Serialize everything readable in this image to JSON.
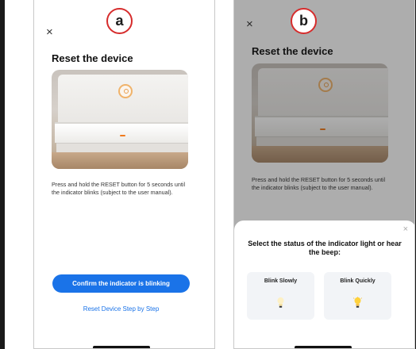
{
  "panels": {
    "a": {
      "badge": "a",
      "close": "×",
      "title": "Reset the device",
      "description": "Press and hold the RESET button for 5 seconds until the indicator blinks (subject to the user manual).",
      "confirm_button": "Confirm the indicator is blinking",
      "step_link": "Reset Device Step by Step"
    },
    "b": {
      "badge": "b",
      "close": "×",
      "title": "Reset the device",
      "description": "Press and hold the RESET button for 5 seconds until the indicator blinks (subject to the user manual).",
      "sheet": {
        "close": "×",
        "title": "Select the status of the indicator light or hear the beep:",
        "options": [
          {
            "label": "Blink Slowly",
            "icon": "bulb-dim-icon"
          },
          {
            "label": "Blink Quickly",
            "icon": "bulb-bright-icon"
          }
        ]
      }
    }
  },
  "colors": {
    "accent": "#1a73e8",
    "badge_border": "#d62c2c",
    "indicator_led": "#f07a1c"
  }
}
